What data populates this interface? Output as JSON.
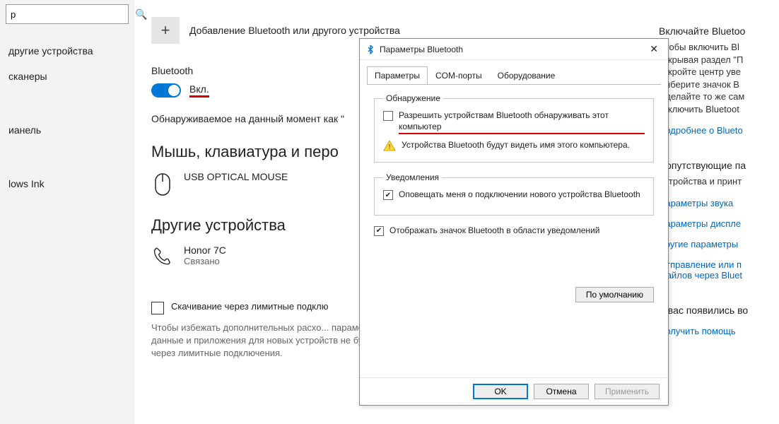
{
  "sidebar": {
    "search_placeholder": "р",
    "items": [
      "другие устройства",
      "сканеры",
      "ианель",
      "lows Ink"
    ]
  },
  "main": {
    "add_device": "Добавление Bluetooth или другого устройства",
    "bt_heading": "Bluetooth",
    "toggle_label": "Вкл.",
    "discovering": "Обнаруживаемое на данный момент как \"",
    "mouse_heading": "Мышь, клавиатура и перо",
    "mouse_name": "USB OPTICAL MOUSE",
    "other_heading": "Другие устройства",
    "phone_name": "Honor 7C",
    "phone_status": "Связано",
    "metered_label": "Скачивание через лимитные подклю",
    "metered_explain": "Чтобы избежать дополнительных расхо...  параметр. Драйверы, данные и приложения для новых устройств не будут скачиваться через лимитные подключения."
  },
  "right": {
    "h1": "Включайте Bluetoo",
    "p1": "Чтобы включить Bl открывая раздел \"П откройте центр уве выберите значок B Сделайте то же сам отключить Bluetoot",
    "more_link": "Подробнее о Blueto",
    "h2": "Сопутствующие па",
    "p2": "Устройства и принт",
    "links": [
      "Параметры звука",
      "Параметры диспле",
      "Другие параметры",
      "Отправление или п файлов через Bluet"
    ],
    "h3": "У вас появились во",
    "help_link": "Получить помощь"
  },
  "dialog": {
    "title": "Параметры Bluetooth",
    "tabs": [
      "Параметры",
      "COM-порты",
      "Оборудование"
    ],
    "discovery_legend": "Обнаружение",
    "discovery_cb": "Разрешить устройствам Bluetooth обнаруживать этот компьютер",
    "discovery_warn": "Устройства Bluetooth будут видеть имя этого компьютера.",
    "notify_legend": "Уведомления",
    "notify_cb": "Оповещать меня о подключении нового устройства Bluetooth",
    "tray_cb": "Отображать значок Bluetooth в области уведомлений",
    "default_btn": "По умолчанию",
    "ok": "OK",
    "cancel": "Отмена",
    "apply": "Применить"
  }
}
